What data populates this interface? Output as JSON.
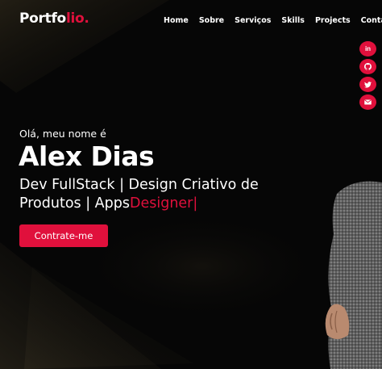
{
  "header": {
    "logo_main": "Portfo",
    "logo_accent": "lio."
  },
  "nav": {
    "items": [
      "Home",
      "Sobre",
      "Serviços",
      "Skills",
      "Projects",
      "Contato"
    ]
  },
  "social": {
    "icons": [
      "linkedin-icon",
      "github-icon",
      "twitter-icon",
      "mail-icon"
    ],
    "linkedin_glyph": "in"
  },
  "hero": {
    "greeting": "Olá, meu nome é",
    "name": "Alex Dias",
    "role_text": "Dev FullStack | Design Criativo de Produtos | Apps",
    "typed_word": "Designer",
    "cursor": "|",
    "cta_label": "Contrate-me"
  },
  "colors": {
    "accent": "#e0103c",
    "background": "#060606",
    "text": "#ffffff"
  }
}
